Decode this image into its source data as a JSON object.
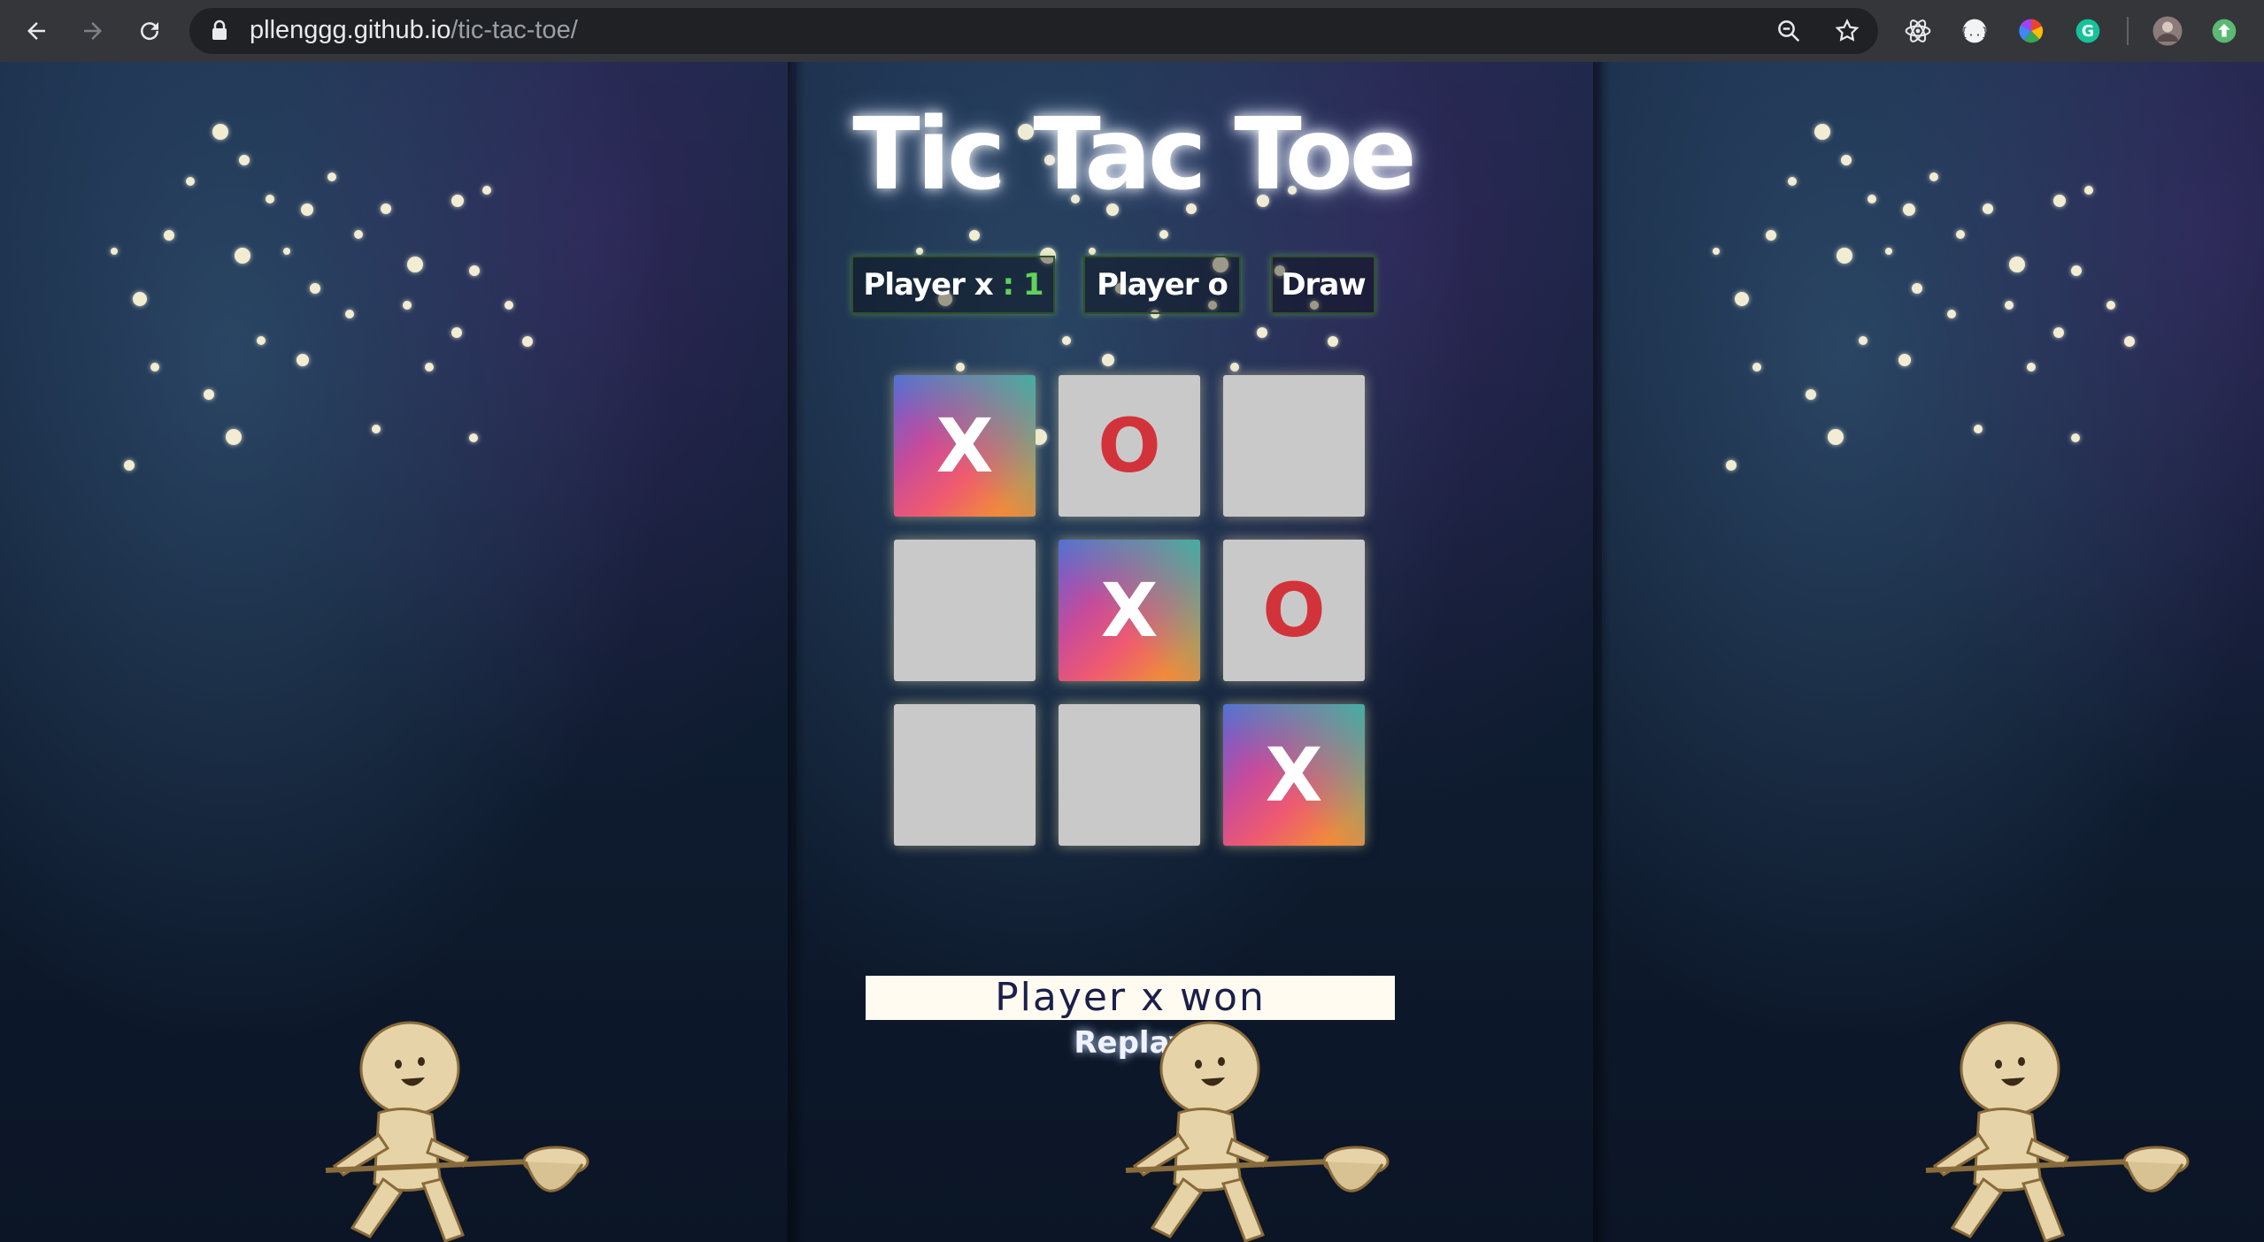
{
  "browser": {
    "url_host": "pllenggg.github.io",
    "url_path": "/tic-tac-toe/"
  },
  "game": {
    "title": "Tic Tac Toe",
    "scoreboard": {
      "player_x_label": "Player x",
      "player_x_separator": " : ",
      "player_x_score": "1",
      "player_o_label": "Player o",
      "draw_label": "Draw"
    },
    "board": [
      [
        "X",
        "O",
        ""
      ],
      [
        "",
        "X",
        "O"
      ],
      [
        "",
        "",
        "X"
      ]
    ],
    "winning_cells": [
      [
        0,
        0
      ],
      [
        1,
        1
      ],
      [
        2,
        2
      ]
    ],
    "result_text": "Player x won",
    "replay_label": "Replay"
  },
  "colors": {
    "x_mark": "#ffffff",
    "o_mark": "#d2333a",
    "empty_cell": "#c9c9c9",
    "score_value": "#5fd35a",
    "result_text": "#1b1f4a"
  }
}
